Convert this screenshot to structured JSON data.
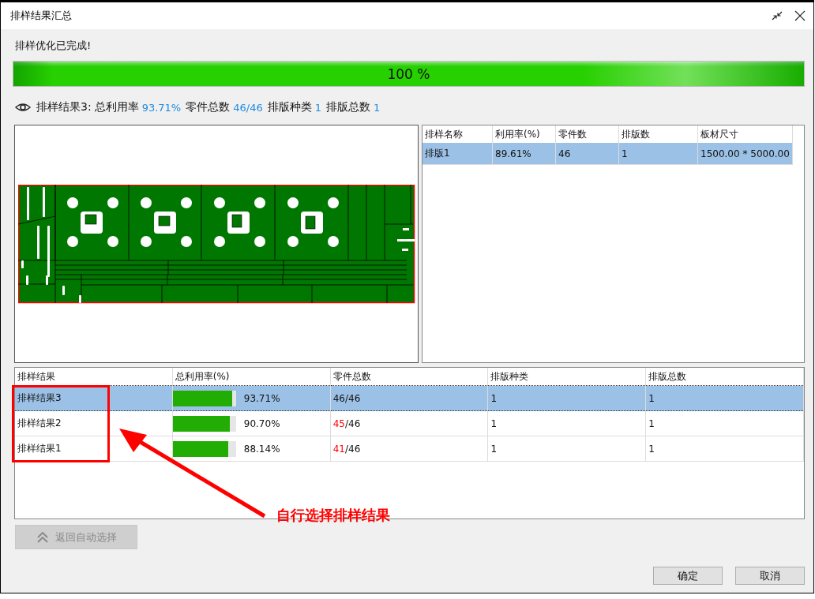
{
  "window": {
    "title": "排样结果汇总"
  },
  "status_text": "排样优化已完成!",
  "progress": {
    "level": 1,
    "text": "100 %"
  },
  "summary": {
    "title": "排样结果3:",
    "stats": [
      {
        "label": "总利用率",
        "value": "93.71%"
      },
      {
        "label": "零件总数",
        "value": "46/46"
      },
      {
        "label": "排版种类",
        "value": "1"
      },
      {
        "label": "排版总数",
        "value": "1"
      }
    ]
  },
  "plates": {
    "columns": [
      "排样名称",
      "利用率(%)",
      "零件数",
      "排版数",
      "板材尺寸"
    ],
    "rows": [
      {
        "name": "排版1",
        "utilization": "89.61%",
        "parts": "46",
        "count": "1",
        "size": "1500.00 * 5000.00",
        "selected": true
      }
    ]
  },
  "results": {
    "columns": [
      "排样结果",
      "总利用率(%)",
      "零件总数",
      "排版种类",
      "排版总数"
    ],
    "rows": [
      {
        "name": "排样结果3",
        "level": 0.9371,
        "utilization": "93.71%",
        "parts_placed": "46",
        "parts_total": "/46",
        "parts_short": false,
        "layout_types": "1",
        "layout_total": "1",
        "selected": true
      },
      {
        "name": "排样结果2",
        "level": 0.907,
        "utilization": "90.70%",
        "parts_placed": "45",
        "parts_total": "/46",
        "parts_short": true,
        "layout_types": "1",
        "layout_total": "1",
        "selected": false
      },
      {
        "name": "排样结果1",
        "level": 0.8814,
        "utilization": "88.14%",
        "parts_placed": "41",
        "parts_total": "/46",
        "parts_short": true,
        "layout_types": "1",
        "layout_total": "1",
        "selected": false
      }
    ]
  },
  "auto_select_button": {
    "label": "返回自动选择",
    "disabled": true
  },
  "buttons": [
    "确定",
    "取消"
  ],
  "annotation": {
    "text": "自行选择排样结果"
  }
}
